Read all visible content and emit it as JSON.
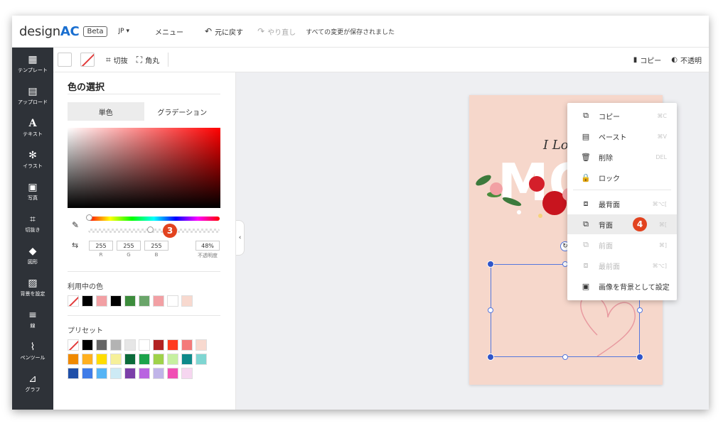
{
  "app": {
    "logo_text": "design",
    "logo_brand": "AC",
    "beta": "Beta",
    "lang": "JP ▾"
  },
  "topbar": {
    "menu": "メニュー",
    "undo": "元に戻す",
    "redo": "やり直し",
    "status": "すべての変更が保存されました"
  },
  "sidebar": {
    "items": [
      {
        "label": "テンプレート",
        "icon": "template-icon"
      },
      {
        "label": "アップロード",
        "icon": "upload-icon"
      },
      {
        "label": "テキスト",
        "icon": "text-icon"
      },
      {
        "label": "イラスト",
        "icon": "illust-icon"
      },
      {
        "label": "写真",
        "icon": "photo-icon"
      },
      {
        "label": "切抜き",
        "icon": "crop-icon"
      },
      {
        "label": "図形",
        "icon": "shape-icon"
      },
      {
        "label": "背景を設定",
        "icon": "background-icon"
      },
      {
        "label": "線",
        "icon": "line-icon"
      },
      {
        "label": "ペンツール",
        "icon": "pen-icon"
      },
      {
        "label": "グラフ",
        "icon": "graph-icon"
      }
    ]
  },
  "toolbar": {
    "crop": "切抜",
    "round": "角丸",
    "copy": "コピー",
    "opacity": "不透明"
  },
  "panel": {
    "title": "色の選択",
    "tab_solid": "単色",
    "tab_gradient": "グラデーション",
    "badge_alpha": "3",
    "rgb": {
      "r": "255",
      "g": "255",
      "b": "255",
      "opacity": "48%",
      "r_label": "R",
      "g_label": "G",
      "b_label": "B",
      "opacity_label": "不透明度"
    },
    "in_use_title": "利用中の色",
    "in_use_colors": [
      "none",
      "#000000",
      "#f2a0a4",
      "#000000",
      "#3c8c3c",
      "#6aa56a",
      "#f2a0a4",
      "#ffffff",
      "#f8d9cf"
    ],
    "preset_title": "プリセット",
    "preset_colors": [
      [
        "none",
        "#000000",
        "#666666",
        "#b3b3b3",
        "#e6e6e6",
        "#ffffff",
        "#b22222",
        "#ff3b1f",
        "#f47a7a",
        "#f8d9cf"
      ],
      [
        "#f08a00",
        "#ffb020",
        "#ffdd00",
        "#f6f09a",
        "#0b6b3a",
        "#1ca34a",
        "#9fd24a",
        "#c6f0a0",
        "#0e8a8a",
        "#7fd6d2"
      ],
      [
        "#1f4fa8",
        "#3f7ce8",
        "#55b4f5",
        "#cdeaf5",
        "#7b3fa8",
        "#b964e0",
        "#c0b4e8",
        "#f04fb4",
        "#f6d6f0"
      ]
    ]
  },
  "canvas": {
    "card_text": "I Lo"
  },
  "context_menu": {
    "items": [
      {
        "label": "コピー",
        "shortcut": "⌘C",
        "icon": "copy-icon",
        "state": "normal"
      },
      {
        "label": "ペースト",
        "shortcut": "⌘V",
        "icon": "paste-icon",
        "state": "normal"
      },
      {
        "label": "削除",
        "shortcut": "DEL",
        "icon": "trash-icon",
        "state": "normal"
      },
      {
        "label": "ロック",
        "shortcut": "",
        "icon": "lock-icon",
        "state": "normal"
      },
      {
        "label": "最背面",
        "shortcut": "⌘⌥[",
        "icon": "send-to-back-icon",
        "state": "normal"
      },
      {
        "label": "背面",
        "shortcut": "⌘[",
        "icon": "send-backward-icon",
        "state": "highlight"
      },
      {
        "label": "前面",
        "shortcut": "⌘]",
        "icon": "bring-forward-icon",
        "state": "disabled"
      },
      {
        "label": "最前面",
        "shortcut": "⌘⌥]",
        "icon": "bring-to-front-icon",
        "state": "disabled"
      },
      {
        "label": "画像を背景として設定",
        "shortcut": "",
        "icon": "image-icon",
        "state": "normal"
      }
    ],
    "badge": "4"
  }
}
